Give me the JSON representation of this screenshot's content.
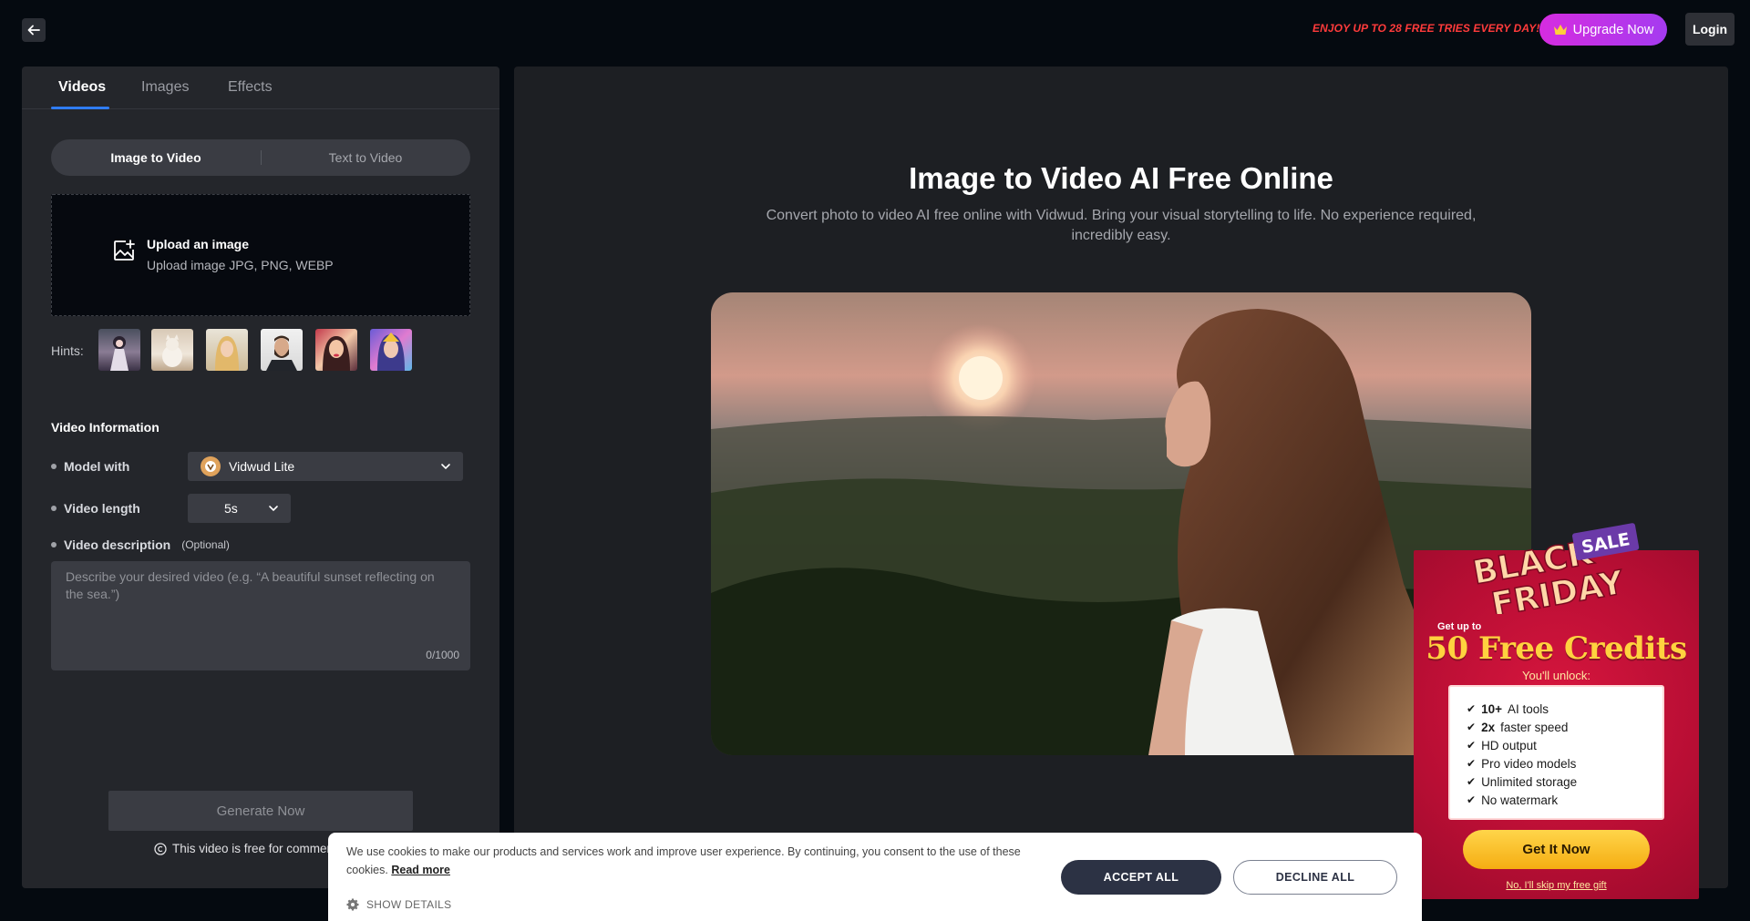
{
  "header": {
    "back_icon": "arrow-left-icon",
    "promo": "ENJOY UP TO 28 FREE TRIES EVERY DAY!",
    "upgrade_label": "Upgrade Now",
    "upgrade_icon": "crown-icon",
    "login_label": "Login"
  },
  "tabs": [
    {
      "label": "Videos",
      "active": true
    },
    {
      "label": "Images",
      "active": false
    },
    {
      "label": "Effects",
      "active": false
    }
  ],
  "mode": {
    "options": [
      "Image to Video",
      "Text to Video"
    ],
    "selected": "Image to Video"
  },
  "upload": {
    "icon": "image-add-icon",
    "title": "Upload an image",
    "subtitle": "Upload image JPG, PNG, WEBP"
  },
  "hints": {
    "label": "Hints:",
    "count": 6
  },
  "video_info": {
    "title": "Video Information",
    "model_label": "Model with",
    "model_value": "Vidwud Lite",
    "length_label": "Video length",
    "length_value": "5s",
    "desc_label": "Video description",
    "desc_optional": "(Optional)",
    "desc_placeholder": "Describe your desired video (e.g. “A beautiful sunset reflecting on the sea.”)",
    "desc_value": "",
    "counter": "0/1000"
  },
  "generate_label": "Generate Now",
  "free_note": "This video is free for commerc",
  "hero": {
    "title": "Image to Video AI Free Online",
    "subtitle": "Convert photo to video AI free online with Vidwud. Bring your visual storytelling to life. No experience required, incredibly easy."
  },
  "promo_popup": {
    "logo_line1": "BLACK",
    "logo_line2": "FRIDAY",
    "logo_tag": "SALE",
    "get_up_to": "Get up to",
    "credits": "50 Free Credits",
    "unlock": "You'll unlock:",
    "features": [
      {
        "bold": "10+",
        "text": "AI tools"
      },
      {
        "bold": "2x",
        "text": "faster speed"
      },
      {
        "bold": "",
        "text": "HD output"
      },
      {
        "bold": "",
        "text": "Pro video models"
      },
      {
        "bold": "",
        "text": "Unlimited storage"
      },
      {
        "bold": "",
        "text": "No watermark"
      }
    ],
    "cta": "Get It Now",
    "skip": "No, I'll skip my free gift"
  },
  "cookie": {
    "text": "We use cookies to make our products and services work and improve user experience. By continuing, you consent to the use of these cookies.",
    "read_more": "Read more",
    "show_details": "SHOW DETAILS",
    "accept": "ACCEPT ALL",
    "decline": "DECLINE ALL"
  },
  "colors": {
    "accent_blue": "#2f7cf6",
    "promo_red": "#ff3b3b",
    "upgrade_gradient_start": "#d62ce0",
    "upgrade_gradient_end": "#a53bf0",
    "popup_red": "#c8103a",
    "popup_gold": "#ffd23f"
  }
}
